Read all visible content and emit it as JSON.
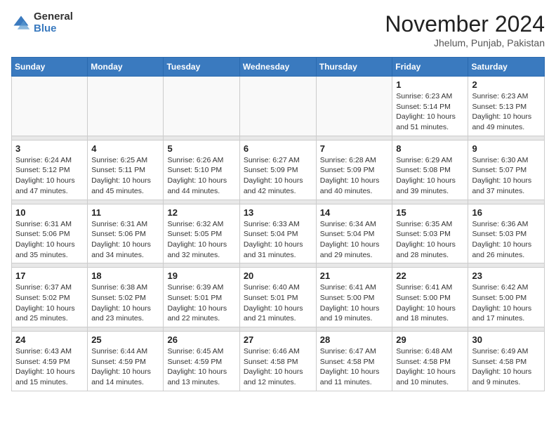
{
  "header": {
    "logo_general": "General",
    "logo_blue": "Blue",
    "month_title": "November 2024",
    "subtitle": "Jhelum, Punjab, Pakistan"
  },
  "weekdays": [
    "Sunday",
    "Monday",
    "Tuesday",
    "Wednesday",
    "Thursday",
    "Friday",
    "Saturday"
  ],
  "weeks": [
    [
      {
        "day": "",
        "info": ""
      },
      {
        "day": "",
        "info": ""
      },
      {
        "day": "",
        "info": ""
      },
      {
        "day": "",
        "info": ""
      },
      {
        "day": "",
        "info": ""
      },
      {
        "day": "1",
        "info": "Sunrise: 6:23 AM\nSunset: 5:14 PM\nDaylight: 10 hours\nand 51 minutes."
      },
      {
        "day": "2",
        "info": "Sunrise: 6:23 AM\nSunset: 5:13 PM\nDaylight: 10 hours\nand 49 minutes."
      }
    ],
    [
      {
        "day": "3",
        "info": "Sunrise: 6:24 AM\nSunset: 5:12 PM\nDaylight: 10 hours\nand 47 minutes."
      },
      {
        "day": "4",
        "info": "Sunrise: 6:25 AM\nSunset: 5:11 PM\nDaylight: 10 hours\nand 45 minutes."
      },
      {
        "day": "5",
        "info": "Sunrise: 6:26 AM\nSunset: 5:10 PM\nDaylight: 10 hours\nand 44 minutes."
      },
      {
        "day": "6",
        "info": "Sunrise: 6:27 AM\nSunset: 5:09 PM\nDaylight: 10 hours\nand 42 minutes."
      },
      {
        "day": "7",
        "info": "Sunrise: 6:28 AM\nSunset: 5:09 PM\nDaylight: 10 hours\nand 40 minutes."
      },
      {
        "day": "8",
        "info": "Sunrise: 6:29 AM\nSunset: 5:08 PM\nDaylight: 10 hours\nand 39 minutes."
      },
      {
        "day": "9",
        "info": "Sunrise: 6:30 AM\nSunset: 5:07 PM\nDaylight: 10 hours\nand 37 minutes."
      }
    ],
    [
      {
        "day": "10",
        "info": "Sunrise: 6:31 AM\nSunset: 5:06 PM\nDaylight: 10 hours\nand 35 minutes."
      },
      {
        "day": "11",
        "info": "Sunrise: 6:31 AM\nSunset: 5:06 PM\nDaylight: 10 hours\nand 34 minutes."
      },
      {
        "day": "12",
        "info": "Sunrise: 6:32 AM\nSunset: 5:05 PM\nDaylight: 10 hours\nand 32 minutes."
      },
      {
        "day": "13",
        "info": "Sunrise: 6:33 AM\nSunset: 5:04 PM\nDaylight: 10 hours\nand 31 minutes."
      },
      {
        "day": "14",
        "info": "Sunrise: 6:34 AM\nSunset: 5:04 PM\nDaylight: 10 hours\nand 29 minutes."
      },
      {
        "day": "15",
        "info": "Sunrise: 6:35 AM\nSunset: 5:03 PM\nDaylight: 10 hours\nand 28 minutes."
      },
      {
        "day": "16",
        "info": "Sunrise: 6:36 AM\nSunset: 5:03 PM\nDaylight: 10 hours\nand 26 minutes."
      }
    ],
    [
      {
        "day": "17",
        "info": "Sunrise: 6:37 AM\nSunset: 5:02 PM\nDaylight: 10 hours\nand 25 minutes."
      },
      {
        "day": "18",
        "info": "Sunrise: 6:38 AM\nSunset: 5:02 PM\nDaylight: 10 hours\nand 23 minutes."
      },
      {
        "day": "19",
        "info": "Sunrise: 6:39 AM\nSunset: 5:01 PM\nDaylight: 10 hours\nand 22 minutes."
      },
      {
        "day": "20",
        "info": "Sunrise: 6:40 AM\nSunset: 5:01 PM\nDaylight: 10 hours\nand 21 minutes."
      },
      {
        "day": "21",
        "info": "Sunrise: 6:41 AM\nSunset: 5:00 PM\nDaylight: 10 hours\nand 19 minutes."
      },
      {
        "day": "22",
        "info": "Sunrise: 6:41 AM\nSunset: 5:00 PM\nDaylight: 10 hours\nand 18 minutes."
      },
      {
        "day": "23",
        "info": "Sunrise: 6:42 AM\nSunset: 5:00 PM\nDaylight: 10 hours\nand 17 minutes."
      }
    ],
    [
      {
        "day": "24",
        "info": "Sunrise: 6:43 AM\nSunset: 4:59 PM\nDaylight: 10 hours\nand 15 minutes."
      },
      {
        "day": "25",
        "info": "Sunrise: 6:44 AM\nSunset: 4:59 PM\nDaylight: 10 hours\nand 14 minutes."
      },
      {
        "day": "26",
        "info": "Sunrise: 6:45 AM\nSunset: 4:59 PM\nDaylight: 10 hours\nand 13 minutes."
      },
      {
        "day": "27",
        "info": "Sunrise: 6:46 AM\nSunset: 4:58 PM\nDaylight: 10 hours\nand 12 minutes."
      },
      {
        "day": "28",
        "info": "Sunrise: 6:47 AM\nSunset: 4:58 PM\nDaylight: 10 hours\nand 11 minutes."
      },
      {
        "day": "29",
        "info": "Sunrise: 6:48 AM\nSunset: 4:58 PM\nDaylight: 10 hours\nand 10 minutes."
      },
      {
        "day": "30",
        "info": "Sunrise: 6:49 AM\nSunset: 4:58 PM\nDaylight: 10 hours\nand 9 minutes."
      }
    ]
  ]
}
